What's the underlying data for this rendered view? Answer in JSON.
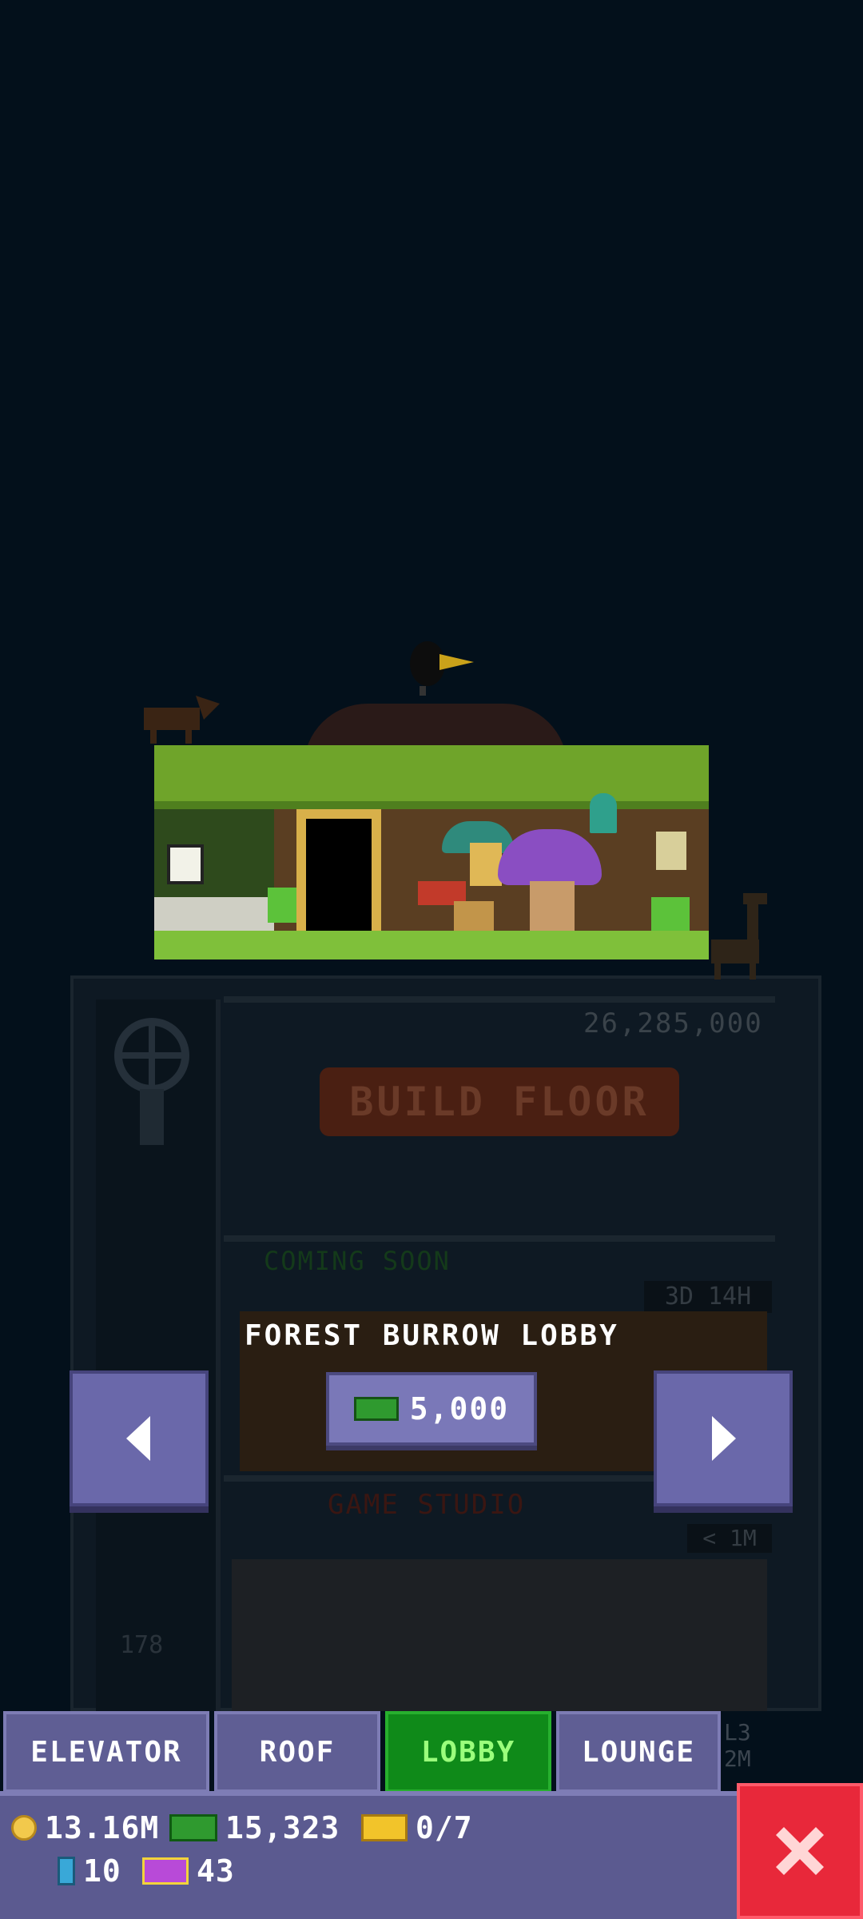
{
  "tower": {
    "build_floor_price": "26,285,000",
    "build_floor_label": "BUILD FLOOR",
    "coming_soon": "COMING SOON",
    "timer_3d": "3D 14H",
    "game_studio": "GAME STUDIO",
    "timer_1m": "< 1M",
    "floor_number": "178",
    "side_fragment_1": "L3",
    "side_fragment_2": "2M"
  },
  "lobby_preview": {
    "title": "FOREST BURROW LOBBY",
    "price": "5,000",
    "currency_icon": "bux-icon"
  },
  "tabs": [
    {
      "label": "ELEVATOR",
      "active": false
    },
    {
      "label": "ROOF",
      "active": false
    },
    {
      "label": "LOBBY",
      "active": true
    },
    {
      "label": "LOUNGE",
      "active": false
    }
  ],
  "status": {
    "coins": "13.16M",
    "bux": "15,323",
    "tickets": "0/7",
    "bitbooks": "10",
    "vip": "43"
  },
  "colors": {
    "background": "#03101b",
    "tab_active": "#0f8a19",
    "tab_inactive": "#5f5e94",
    "close": "#e8283a"
  }
}
